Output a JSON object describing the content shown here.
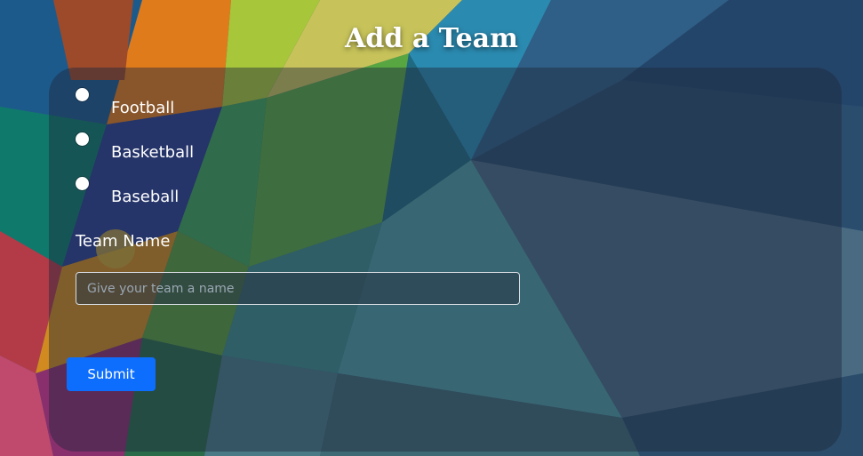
{
  "page": {
    "title": "Add a Team"
  },
  "form": {
    "sports": [
      {
        "label": "Football",
        "checked": false
      },
      {
        "label": "Basketball",
        "checked": false
      },
      {
        "label": "Baseball",
        "checked": false
      }
    ],
    "team_name_label": "Team Name",
    "team_name_placeholder": "Give your team a name",
    "team_name_value": "",
    "submit_label": "Submit"
  },
  "colors": {
    "submit_button": "#0d6efd",
    "panel_overlay": "rgba(30,40,60,0.45)",
    "text": "#ffffff"
  }
}
